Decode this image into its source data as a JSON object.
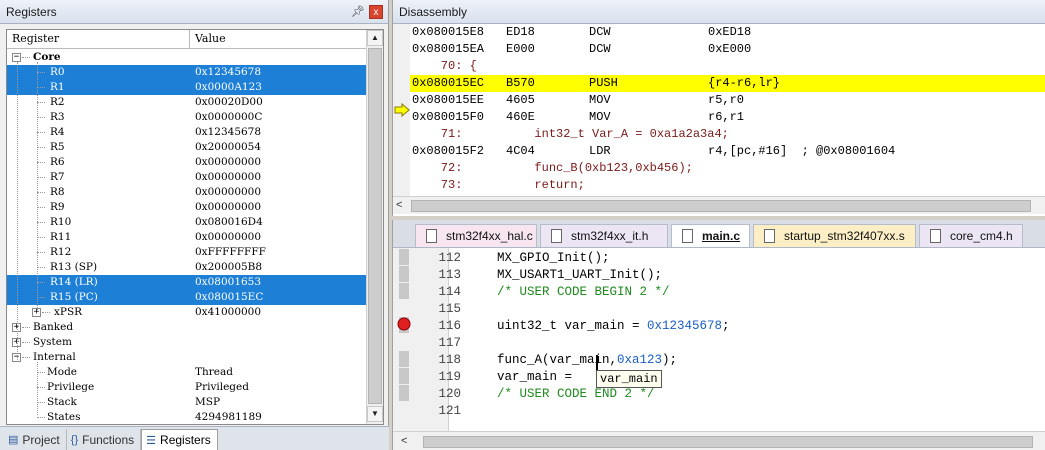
{
  "registers_pane": {
    "title": "Registers",
    "pin_glyph": "ட",
    "close_glyph": "x",
    "col_register": "Register",
    "col_value": "Value",
    "rows": [
      {
        "label": "Core",
        "value": "",
        "kind": "group",
        "exp": "−"
      },
      {
        "label": "R0",
        "value": "0x12345678",
        "sel": true
      },
      {
        "label": "R1",
        "value": "0x0000A123",
        "sel": true
      },
      {
        "label": "R2",
        "value": "0x00020D00"
      },
      {
        "label": "R3",
        "value": "0x0000000C"
      },
      {
        "label": "R4",
        "value": "0x12345678"
      },
      {
        "label": "R5",
        "value": "0x20000054"
      },
      {
        "label": "R6",
        "value": "0x00000000"
      },
      {
        "label": "R7",
        "value": "0x00000000"
      },
      {
        "label": "R8",
        "value": "0x00000000"
      },
      {
        "label": "R9",
        "value": "0x00000000"
      },
      {
        "label": "R10",
        "value": "0x080016D4"
      },
      {
        "label": "R11",
        "value": "0x00000000"
      },
      {
        "label": "R12",
        "value": "0xFFFFFFFF"
      },
      {
        "label": "R13 (SP)",
        "value": "0x200005B8"
      },
      {
        "label": "R14 (LR)",
        "value": "0x08001653",
        "sel": true
      },
      {
        "label": "R15 (PC)",
        "value": "0x080015EC",
        "sel": true
      },
      {
        "label": "xPSR",
        "value": "0x41000000",
        "kind": "subexp",
        "exp": "+"
      },
      {
        "label": "Banked",
        "value": "",
        "kind": "group2",
        "exp": "+"
      },
      {
        "label": "System",
        "value": "",
        "kind": "group2",
        "exp": "+"
      },
      {
        "label": "Internal",
        "value": "",
        "kind": "group2",
        "exp": "−"
      },
      {
        "label": "Mode",
        "value": "Thread",
        "kind": "leaf2"
      },
      {
        "label": "Privilege",
        "value": "Privileged",
        "kind": "leaf2"
      },
      {
        "label": "Stack",
        "value": "MSP",
        "kind": "leaf2"
      },
      {
        "label": "States",
        "value": "4294981189",
        "kind": "leaf2"
      }
    ],
    "bottom_tabs": [
      {
        "label": "Project",
        "icon": "▤"
      },
      {
        "label": "Functions",
        "icon": "{}"
      },
      {
        "label": "Registers",
        "icon": "☰",
        "active": true
      }
    ]
  },
  "disassembly": {
    "title": "Disassembly",
    "lines": [
      {
        "addr": "0x080015E8",
        "op": "ED18",
        "mn": "DCW",
        "arg": "0xED18"
      },
      {
        "addr": "0x080015EA",
        "op": "E000",
        "mn": "DCW",
        "arg": "0xE000"
      },
      {
        "src": "    70: {"
      },
      {
        "addr": "0x080015EC",
        "op": "B570",
        "mn": "PUSH",
        "arg": "{r4-r6,lr}",
        "current": true
      },
      {
        "addr": "0x080015EE",
        "op": "4605",
        "mn": "MOV",
        "arg": "r5,r0"
      },
      {
        "addr": "0x080015F0",
        "op": "460E",
        "mn": "MOV",
        "arg": "r6,r1"
      },
      {
        "src": "    71:          int32_t Var_A = 0xa1a2a3a4;"
      },
      {
        "addr": "0x080015F2",
        "op": "4C04",
        "mn": "LDR",
        "arg": "r4,[pc,#16]  ; @0x08001604"
      },
      {
        "src": "    72:          func_B(0xb123,0xb456);"
      },
      {
        "src": "    73:          return;"
      }
    ],
    "scroll_left_glyph": "<"
  },
  "editor": {
    "tabs": [
      {
        "label": "stm32f4xx_hal.c"
      },
      {
        "label": "stm32f4xx_it.h"
      },
      {
        "label": "main.c",
        "active": true
      },
      {
        "label": "startup_stm32f407xx.s"
      },
      {
        "label": "core_cm4.h"
      }
    ],
    "lines": [
      {
        "ln": "112",
        "parts": [
          {
            "t": "MX_GPIO_Init();",
            "c": "kw"
          }
        ]
      },
      {
        "ln": "113",
        "parts": [
          {
            "t": "MX_USART1_UART_Init();",
            "c": "kw"
          }
        ]
      },
      {
        "ln": "114",
        "parts": [
          {
            "t": "/* USER CODE BEGIN 2 */",
            "c": "cm"
          }
        ]
      },
      {
        "ln": "115",
        "parts": []
      },
      {
        "ln": "116",
        "parts": [
          {
            "t": "uint32_t var_main = ",
            "c": "kw"
          },
          {
            "t": "0x12345678",
            "c": "num"
          },
          {
            "t": ";",
            "c": "kw"
          }
        ],
        "breakpoint": true
      },
      {
        "ln": "117",
        "parts": []
      },
      {
        "ln": "118",
        "parts": [
          {
            "t": "func_A(var_main,",
            "c": "kw"
          },
          {
            "t": "0xa123",
            "c": "num"
          },
          {
            "t": ");",
            "c": "kw"
          }
        ]
      },
      {
        "ln": "119",
        "parts": [
          {
            "t": "var_main = ",
            "c": "kw"
          }
        ]
      },
      {
        "ln": "120",
        "parts": [
          {
            "t": "/* USER CODE END 2 */",
            "c": "cm"
          }
        ]
      },
      {
        "ln": "121",
        "parts": []
      }
    ],
    "tooltip": "var_main",
    "scroll_left_glyph": "<"
  }
}
